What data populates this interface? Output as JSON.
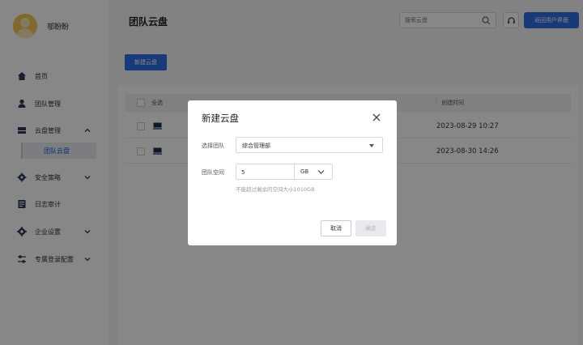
{
  "user": {
    "name": "邬盼盼"
  },
  "sidebar": {
    "items": [
      {
        "label": "首页",
        "icon": "home-icon"
      },
      {
        "label": "团队管理",
        "icon": "user-icon"
      },
      {
        "label": "云盘管理",
        "icon": "cloud-disk-icon"
      },
      {
        "label": "安全策略",
        "icon": "gear-icon"
      },
      {
        "label": "日志审计",
        "icon": "log-icon"
      },
      {
        "label": "企业设置",
        "icon": "settings-icon"
      },
      {
        "label": "专属登录配置",
        "icon": "sliders-icon"
      }
    ],
    "sub_item": {
      "label": "团队云盘"
    }
  },
  "header": {
    "title": "团队云盘",
    "search_placeholder": "搜索云盘",
    "back_label": "返回用户界面"
  },
  "toolbar": {
    "new_label": "新建云盘"
  },
  "table": {
    "select_all_label": "全选",
    "created_time_header": "创建时间",
    "rows": [
      {
        "created": "2023-08-29 10:27"
      },
      {
        "created": "2023-08-30 14:26"
      }
    ]
  },
  "modal": {
    "title": "新建云盘",
    "team_label": "选择团队",
    "team_value": "综合管理部",
    "space_label": "团队空间",
    "space_value": "5",
    "space_unit": "GB",
    "hint": "不能超过剩余的空间大小1010GB",
    "cancel_label": "取消",
    "ok_label": "确定"
  },
  "colors": {
    "accent": "#2f6fe4",
    "active_nav_text": "#1a5bd6"
  }
}
